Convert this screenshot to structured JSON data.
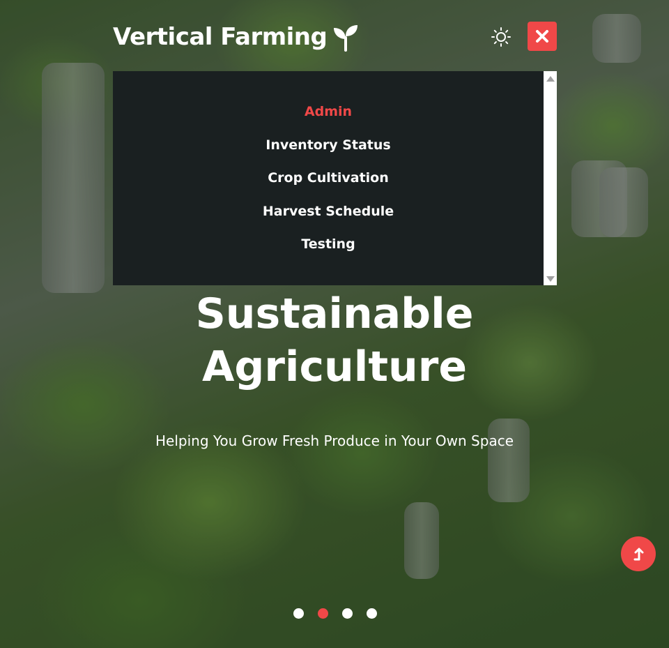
{
  "app": {
    "logo_text": "Vertical Farming",
    "logo_icon": "sprout-icon",
    "accent_color": "#f04848"
  },
  "header": {
    "theme_toggle_icon": "sun-icon",
    "close_icon": "close-icon"
  },
  "menu": {
    "items": [
      {
        "label": "Admin",
        "active": true
      },
      {
        "label": "Inventory Status",
        "active": false
      },
      {
        "label": "Crop Cultivation",
        "active": false
      },
      {
        "label": "Harvest Schedule",
        "active": false
      },
      {
        "label": "Testing",
        "active": false
      }
    ]
  },
  "hero": {
    "title_line1": "Sustainable",
    "title_line2": "Agriculture",
    "subtitle": "Helping You Grow Fresh Produce in Your Own Space"
  },
  "scroll_top": {
    "icon": "arrow-up-icon"
  },
  "carousel": {
    "slide_count": 4,
    "active_index": 1
  }
}
